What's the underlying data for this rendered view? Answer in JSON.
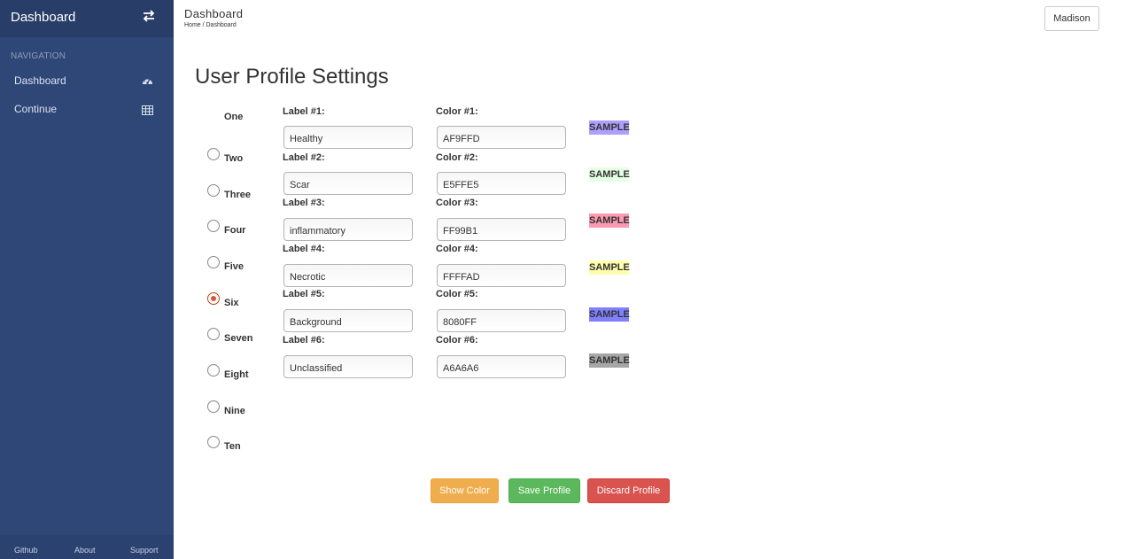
{
  "sidebar": {
    "title": "Dashboard",
    "nav_heading": "NAVIGATION",
    "items": [
      {
        "label": "Dashboard",
        "icon": "dashboard-gauge-icon"
      },
      {
        "label": "Continue",
        "icon": "table-grid-icon"
      }
    ],
    "footer": [
      "Github",
      "About",
      "Support"
    ]
  },
  "header": {
    "title": "Dashboard",
    "breadcrumb": "Home / Dashboard",
    "user": "Madison"
  },
  "main": {
    "title": "User Profile Settings",
    "options": [
      "One",
      "Two",
      "Three",
      "Four",
      "Five",
      "Six",
      "Seven",
      "Eight",
      "Nine",
      "Ten"
    ],
    "selected_option": "Six",
    "rows": [
      {
        "label_title": "Label #1:",
        "label_value": "Healthy",
        "color_title": "Color #1:",
        "color_value": "AF9FFD",
        "sample": "SAMPLE",
        "swatch": "#AF9FFD"
      },
      {
        "label_title": "Label #2:",
        "label_value": "Scar",
        "color_title": "Color #2:",
        "color_value": "E5FFE5",
        "sample": "SAMPLE",
        "swatch": "#E5FFE5"
      },
      {
        "label_title": "Label #3:",
        "label_value": "inflammatory",
        "color_title": "Color #3:",
        "color_value": "FF99B1",
        "sample": "SAMPLE",
        "swatch": "#FF99B1"
      },
      {
        "label_title": "Label #4:",
        "label_value": "Necrotic",
        "color_title": "Color #4:",
        "color_value": "FFFFAD",
        "sample": "SAMPLE",
        "swatch": "#FFFFAD"
      },
      {
        "label_title": "Label #5:",
        "label_value": "Background",
        "color_title": "Color #5:",
        "color_value": "8080FF",
        "sample": "SAMPLE",
        "swatch": "#8080FF"
      },
      {
        "label_title": "Label #6:",
        "label_value": "Unclassified",
        "color_title": "Color #6:",
        "color_value": "A6A6A6",
        "sample": "SAMPLE",
        "swatch": "#A6A6A6"
      }
    ],
    "buttons": [
      {
        "label": "Show Color",
        "color": "#f0ad4e"
      },
      {
        "label": "Save Profile",
        "color": "#5cb85c"
      },
      {
        "label": "Discard Profile",
        "color": "#d9534f"
      }
    ]
  },
  "colors": {
    "sidebar_bg": "#2f4776",
    "sidebar_header_bg": "#283e68",
    "radio_accent": "#d9572a"
  }
}
